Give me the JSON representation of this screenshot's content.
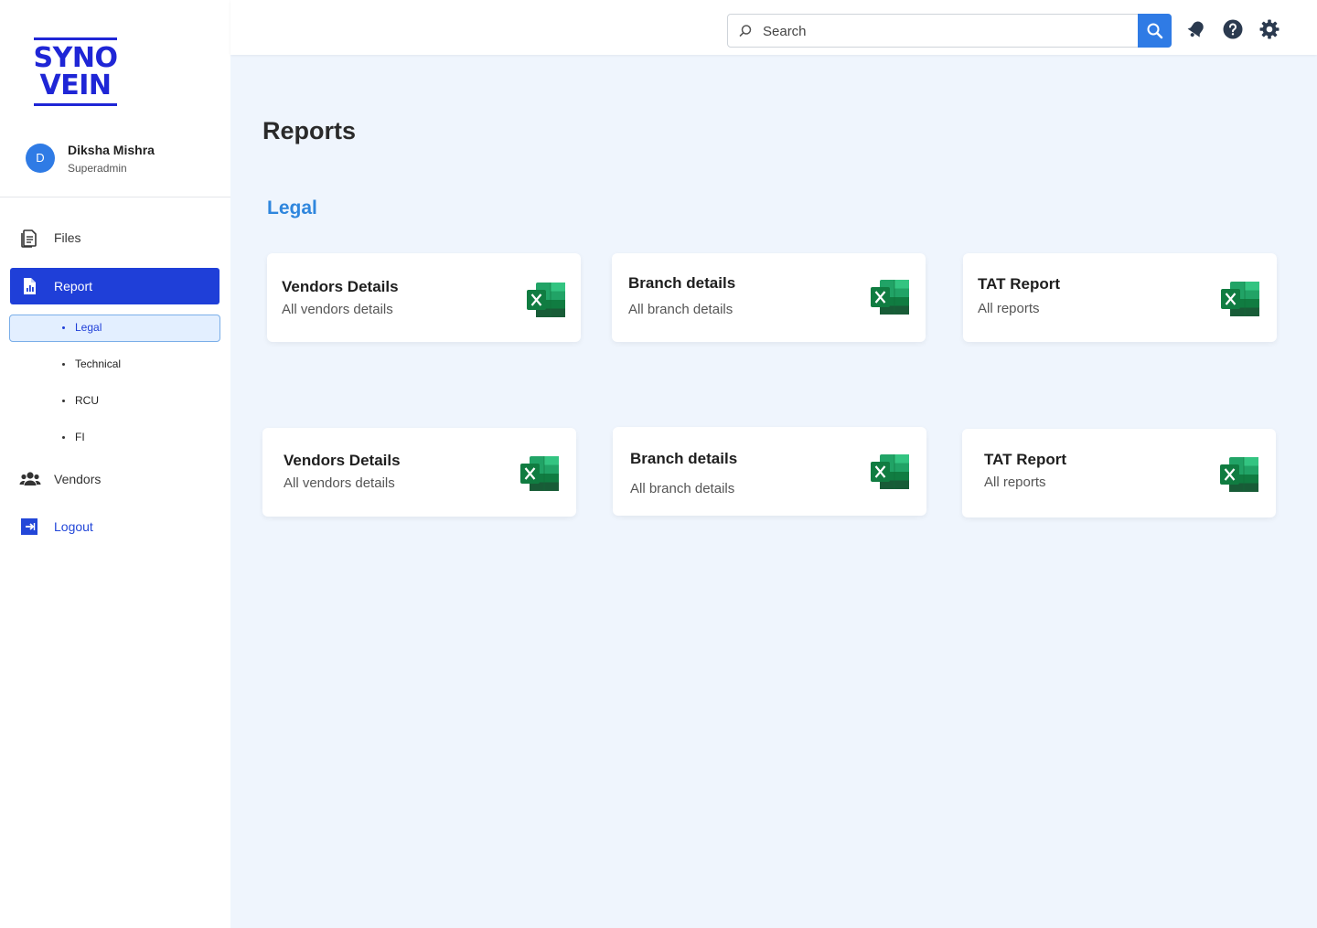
{
  "logo": {
    "line1": "SYNO",
    "line2": "VEIN"
  },
  "user": {
    "initial": "D",
    "name": "Diksha Mishra",
    "role": "Superadmin"
  },
  "sidebar": {
    "items": [
      {
        "label": "Files",
        "icon": "file-icon"
      },
      {
        "label": "Report",
        "icon": "report-icon"
      },
      {
        "label": "Vendors",
        "icon": "users-icon"
      },
      {
        "label": "Logout",
        "icon": "logout-icon"
      }
    ],
    "report_subitems": [
      {
        "label": "Legal"
      },
      {
        "label": "Technical"
      },
      {
        "label": "RCU"
      },
      {
        "label": "FI"
      }
    ]
  },
  "search": {
    "placeholder": "Search"
  },
  "topbar_icons": [
    "search-icon",
    "bell-icon",
    "help-icon",
    "settings-icon"
  ],
  "main": {
    "title": "Reports",
    "section": "Legal",
    "cards": [
      {
        "title": "Vendors Details",
        "subtitle": "All vendors details",
        "icon": "excel-icon"
      },
      {
        "title": "Branch details",
        "subtitle": "All branch details",
        "icon": "excel-icon"
      },
      {
        "title": "TAT Report",
        "subtitle": "All reports",
        "icon": "excel-icon"
      },
      {
        "title": "Vendors Details",
        "subtitle": "All vendors details",
        "icon": "excel-icon"
      },
      {
        "title": "Branch details",
        "subtitle": "All branch details",
        "icon": "excel-icon"
      },
      {
        "title": "TAT Report",
        "subtitle": "All reports",
        "icon": "excel-icon"
      }
    ]
  },
  "colors": {
    "accent": "#1f3fd8",
    "search_button": "#2f7be5",
    "section_title": "#2f86dd",
    "background": "#eff5fd",
    "logo": "#1f26d6"
  }
}
